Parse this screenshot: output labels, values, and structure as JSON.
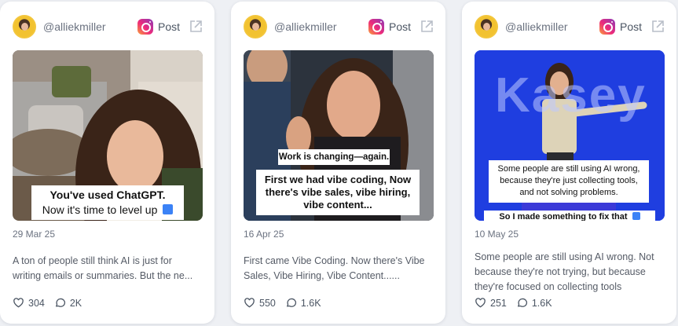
{
  "cards": [
    {
      "handle": "@alliekmiller",
      "post_label": "Post",
      "image_caption_line1": "You've used ChatGPT.",
      "image_caption_line2": "Now it's time to level up",
      "date": "29 Mar 25",
      "description": "A ton of people still think AI is just for writing emails or summaries. But the ne...",
      "likes": "304",
      "comments": "2K"
    },
    {
      "handle": "@alliekmiller",
      "post_label": "Post",
      "image_tag": "Work is changing—again.",
      "image_caption": "First we had vibe coding, Now there's vibe sales, vibe hiring, vibe content...",
      "date": "16 Apr 25",
      "description": "First came Vibe Coding. Now there's Vibe Sales, Vibe Hiring, Vibe Content......",
      "likes": "550",
      "comments": "1.6K"
    },
    {
      "handle": "@alliekmiller",
      "post_label": "Post",
      "image_backdrop_text": "Kasey",
      "image_caption": "Some people are still using AI wrong, because they're just collecting tools, and not solving problems.",
      "image_bottom_text": "So I made something to fix that",
      "date": "10 May 25",
      "description": "Some people are still using AI wrong. Not because they're not trying, but because they're focused on collecting tools",
      "likes": "251",
      "comments": "1.6K"
    }
  ],
  "colors": {
    "page_bg": "#eef0f4",
    "card_bg": "#ffffff",
    "stage_blue": "#1f3ee0",
    "text_muted": "#6b7280"
  }
}
